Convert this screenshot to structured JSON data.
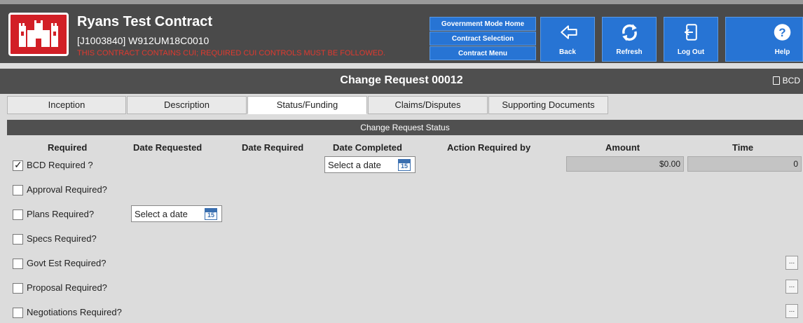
{
  "header": {
    "title": "Ryans Test Contract",
    "subtitle": "[J1003840] W912UM18C0010",
    "cui_warning": "THIS CONTRACT CONTAINS CUI; REQUIRED CUI CONTROLS MUST BE FOLLOWED.",
    "gov_buttons": [
      "Government Mode Home",
      "Contract Selection",
      "Contract Menu"
    ],
    "nav": {
      "back": "Back",
      "refresh": "Refresh",
      "logout": "Log Out",
      "help": "Help"
    }
  },
  "titlebar": {
    "title": "Change Request 00012",
    "bcd_label": "BCD"
  },
  "tabs": [
    "Inception",
    "Description",
    "Status/Funding",
    "Claims/Disputes",
    "Supporting Documents"
  ],
  "active_tab": "Status/Funding",
  "section_title": "Change Request Status",
  "columns": [
    "Required",
    "Date Requested",
    "Date Required",
    "Date Completed",
    "Action Required by",
    "Amount",
    "Time"
  ],
  "rows": [
    {
      "label": "BCD Required ?",
      "checked": true
    },
    {
      "label": "Approval Required?",
      "checked": false
    },
    {
      "label": "Plans Required?",
      "checked": false
    },
    {
      "label": "Specs Required?",
      "checked": false
    },
    {
      "label": "Govt Est Required?",
      "checked": false
    },
    {
      "label": "Proposal Required?",
      "checked": false
    },
    {
      "label": "Negotiations Required?",
      "checked": false
    }
  ],
  "date_placeholder": "Select a date",
  "calendar_day": "15",
  "amount_value": "$0.00",
  "time_value": "0",
  "ellipsis": "...",
  "colors": {
    "header_bg": "#4a4a4a",
    "button_blue": "#2774d4",
    "logo_red": "#d21f26",
    "cui_red": "#e0392f"
  }
}
